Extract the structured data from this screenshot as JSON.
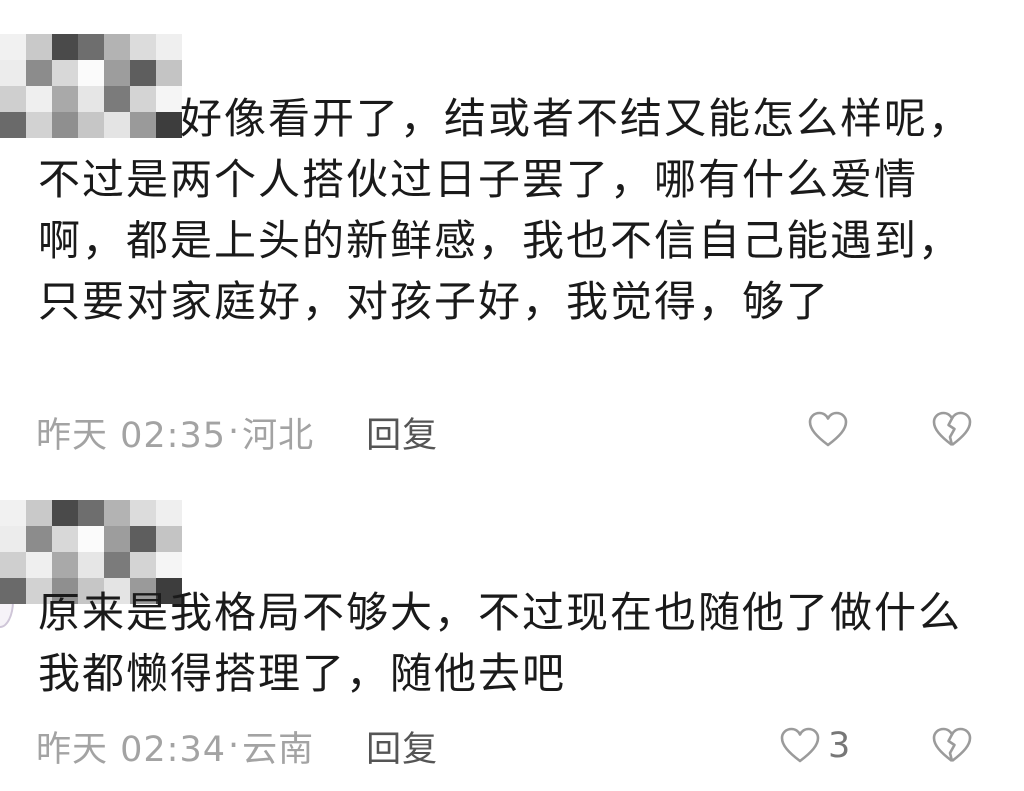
{
  "comments": [
    {
      "username_blurred": true,
      "text": "好像看开了，结或者不结又能怎么样呢，不过是两个人搭伙过日子罢了，哪有什么爱情啊，都是上头的新鲜感，我也不信自己能遇到，只要对家庭好，对孩子好，我觉得，够了",
      "time": "昨天 02:35",
      "separator": "·",
      "location": "河北",
      "reply_label": "回复",
      "like_count": "",
      "like_icon": "heart-outline-icon",
      "dislike_icon": "broken-heart-icon"
    },
    {
      "username_blurred": true,
      "text": "原来是我格局不够大，不过现在也随他了做什么我都懒得搭理了，随他去吧",
      "time": "昨天 02:34",
      "separator": "·",
      "location": "云南",
      "reply_label": "回复",
      "like_count": "3",
      "like_icon": "heart-outline-icon",
      "dislike_icon": "broken-heart-icon"
    }
  ],
  "colors": {
    "body_text": "#1a1a1a",
    "meta_text": "#a3a3a3",
    "reply_text": "#555555",
    "icon_stroke": "#9b9b9b"
  }
}
